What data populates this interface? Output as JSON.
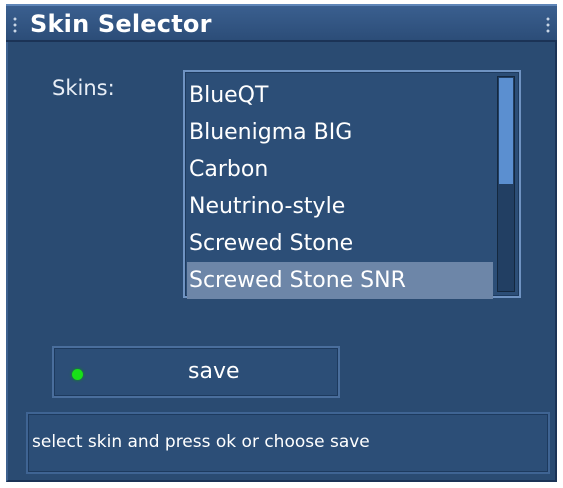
{
  "window": {
    "title": "Skin Selector"
  },
  "skins": {
    "label": "Skins:",
    "items": [
      {
        "label": "BlueQT",
        "selected": false
      },
      {
        "label": "Bluenigma BIG",
        "selected": false
      },
      {
        "label": "Carbon",
        "selected": false
      },
      {
        "label": "Neutrino-style",
        "selected": false
      },
      {
        "label": "Screwed Stone",
        "selected": false
      },
      {
        "label": "Screwed Stone SNR",
        "selected": true
      }
    ],
    "scroll_position": 0,
    "visible_fraction": 0.5
  },
  "save_button": {
    "label": "save",
    "led_color": "#18e018"
  },
  "status": {
    "text": "select skin and press ok or choose save"
  },
  "colors": {
    "panel_bg": "#2a4b72",
    "title_bg": "#3a5f8f",
    "selection_bg": "#6d86a8",
    "scroll_thumb": "#5b8fd0",
    "text": "#ffffff"
  }
}
